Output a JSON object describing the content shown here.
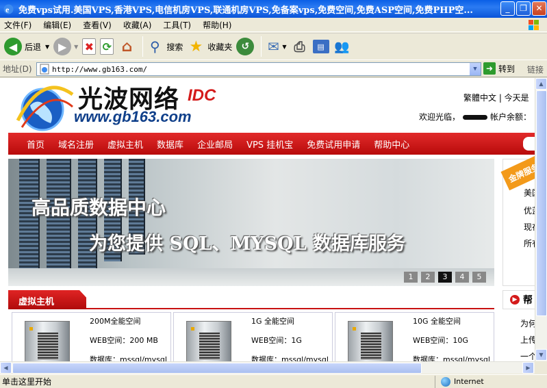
{
  "window": {
    "title": "免费vps试用.美国VPS,香港VPS,电信机房VPS,联通机房VPS,免备案vps,免费空间,免费ASP空间,免费PHP空..."
  },
  "menu": [
    "文件(F)",
    "编辑(E)",
    "查看(V)",
    "收藏(A)",
    "工具(T)",
    "帮助(H)"
  ],
  "toolbar": {
    "back": "后退",
    "search": "搜索",
    "favorites": "收藏夹"
  },
  "address": {
    "label": "地址(D)",
    "url": "http://www.gb163.com/",
    "go": "转到",
    "links": "链接"
  },
  "site": {
    "brand": "光波网络",
    "brand_suffix": "IDC",
    "url": "www.gb163.com",
    "toplinks": "繁體中文 | 今天是",
    "welcome_prefix": "欢迎光临，",
    "welcome_suffix": "帐户余额：",
    "nav": [
      "首页",
      "域名注册",
      "虚拟主机",
      "数据库",
      "企业邮局",
      "VPS 挂机宝",
      "免费试用申请",
      "帮助中心"
    ],
    "banner": {
      "line1": "高品质数据中心",
      "line2": "为您提供 SQL、MYSQL 数据库服务",
      "pages": [
        "1",
        "2",
        "3",
        "4",
        "5"
      ],
      "active_page": "3"
    },
    "side": {
      "tag": "金牌服务",
      "items": [
        "美国",
        "优蓝",
        "现在",
        "所有"
      ]
    },
    "section": "虚拟主机",
    "help": {
      "title": "帮",
      "items": [
        "为何",
        "上传",
        "一个"
      ]
    },
    "cards": [
      {
        "name": "200M全能空间",
        "web": "WEB空间：200 MB",
        "db": "数据库：mssql/mysql"
      },
      {
        "name": "1G 全能空间",
        "web": "WEB空间：1G",
        "db": "数据库：mssql/mysql"
      },
      {
        "name": "10G 全能空间",
        "web": "WEB空间：10G",
        "db": "数据库：mssql/mysql"
      }
    ]
  },
  "status": {
    "message": "单击这里开始",
    "zone": "Internet"
  }
}
